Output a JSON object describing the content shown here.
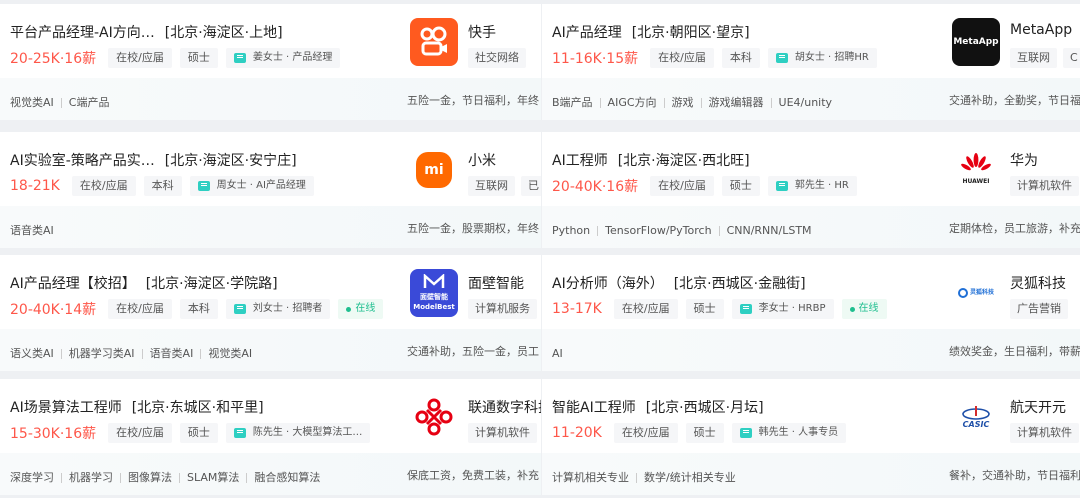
{
  "left": [
    {
      "title": "平台产品经理-AI方向…",
      "location": "[北京·海淀区·上地]",
      "salary": "20-25K·16薪",
      "tags": [
        "在校/应届",
        "硕士"
      ],
      "recruiter": "姜女士 · 产品经理",
      "online": "",
      "skills": [
        "视觉类AI",
        "C端产品"
      ],
      "company": "快手",
      "company_tags": [
        "社交网络"
      ],
      "benefits": "五险一金，节日福利，年终",
      "logo": "kuaishou-logo"
    },
    {
      "title": "AI实验室-策略产品实…",
      "location": "[北京·海淀区·安宁庄]",
      "salary": "18-21K",
      "tags": [
        "在校/应届",
        "本科"
      ],
      "recruiter": "周女士 · AI产品经理",
      "online": "",
      "skills": [
        "语音类AI"
      ],
      "company": "小米",
      "company_tags": [
        "互联网",
        "已"
      ],
      "benefits": "五险一金，股票期权，年终",
      "logo": "xiaomi-logo"
    },
    {
      "title": "AI产品经理【校招】",
      "location": "[北京·海淀区·学院路]",
      "salary": "20-40K·14薪",
      "tags": [
        "在校/应届",
        "本科"
      ],
      "recruiter": "刘女士 · 招聘者",
      "online": "在线",
      "skills": [
        "语义类AI",
        "机器学习类AI",
        "语音类AI",
        "视觉类AI"
      ],
      "company": "面壁智能",
      "company_tags": [
        "计算机服务"
      ],
      "benefits": "交通补助，五险一金，员工",
      "logo": "modelbest-logo",
      "logo_text": "面壁智能 ModelBest"
    },
    {
      "title": "AI场景算法工程师",
      "location": "[北京·东城区·和平里]",
      "salary": "15-30K·16薪",
      "tags": [
        "在校/应届",
        "硕士"
      ],
      "recruiter": "陈先生 · 大模型算法工…",
      "online": "",
      "skills": [
        "深度学习",
        "机器学习",
        "图像算法",
        "SLAM算法",
        "融合感知算法"
      ],
      "company": "联通数字科技",
      "company_tags": [
        "计算机软件"
      ],
      "benefits": "保底工资，免费工装，补充",
      "logo": "unicom-logo"
    }
  ],
  "right": [
    {
      "title": "AI产品经理",
      "location": "[北京·朝阳区·望京]",
      "salary": "11-16K·15薪",
      "tags": [
        "在校/应届",
        "本科"
      ],
      "recruiter": "胡女士 · 招聘HR",
      "online": "",
      "skills": [
        "B端产品",
        "AIGC方向",
        "游戏",
        "游戏编辑器",
        "UE4/unity"
      ],
      "company": "MetaApp",
      "company_tags": [
        "互联网",
        "C"
      ],
      "benefits": "交通补助，全勤奖，节日福",
      "logo": "metaapp-logo",
      "logo_text": "MetaApp"
    },
    {
      "title": "AI工程师",
      "location": "[北京·海淀区·西北旺]",
      "salary": "20-40K·16薪",
      "tags": [
        "在校/应届",
        "硕士"
      ],
      "recruiter": "郭先生 · HR",
      "online": "",
      "skills": [
        "Python",
        "TensorFlow/PyTorch",
        "CNN/RNN/LSTM"
      ],
      "company": "华为",
      "company_tags": [
        "计算机软件"
      ],
      "benefits": "定期体检，员工旅游，补充",
      "logo": "huawei-logo",
      "logo_text": "HUAWEI"
    },
    {
      "title": "AI分析师（海外）",
      "location": "[北京·西城区·金融街]",
      "salary": "13-17K",
      "tags": [
        "在校/应届",
        "硕士"
      ],
      "recruiter": "李女士 · HRBP",
      "online": "在线",
      "skills": [
        "AI"
      ],
      "company": "灵狐科技",
      "company_tags": [
        "广告营销"
      ],
      "benefits": "绩效奖金，生日福利，带薪",
      "logo": "linghu-logo",
      "logo_text": "灵狐科技"
    },
    {
      "title": "智能AI工程师",
      "location": "[北京·西城区·月坛]",
      "salary": "11-20K",
      "tags": [
        "在校/应届",
        "硕士"
      ],
      "recruiter": "韩先生 · 人事专员",
      "online": "",
      "skills": [
        "计算机相关专业",
        "数学/统计相关专业"
      ],
      "company": "航天开元",
      "company_tags": [
        "计算机软件"
      ],
      "benefits": "餐补，交通补助，节日福利",
      "logo": "casic-logo",
      "logo_text": "CASIC"
    }
  ]
}
